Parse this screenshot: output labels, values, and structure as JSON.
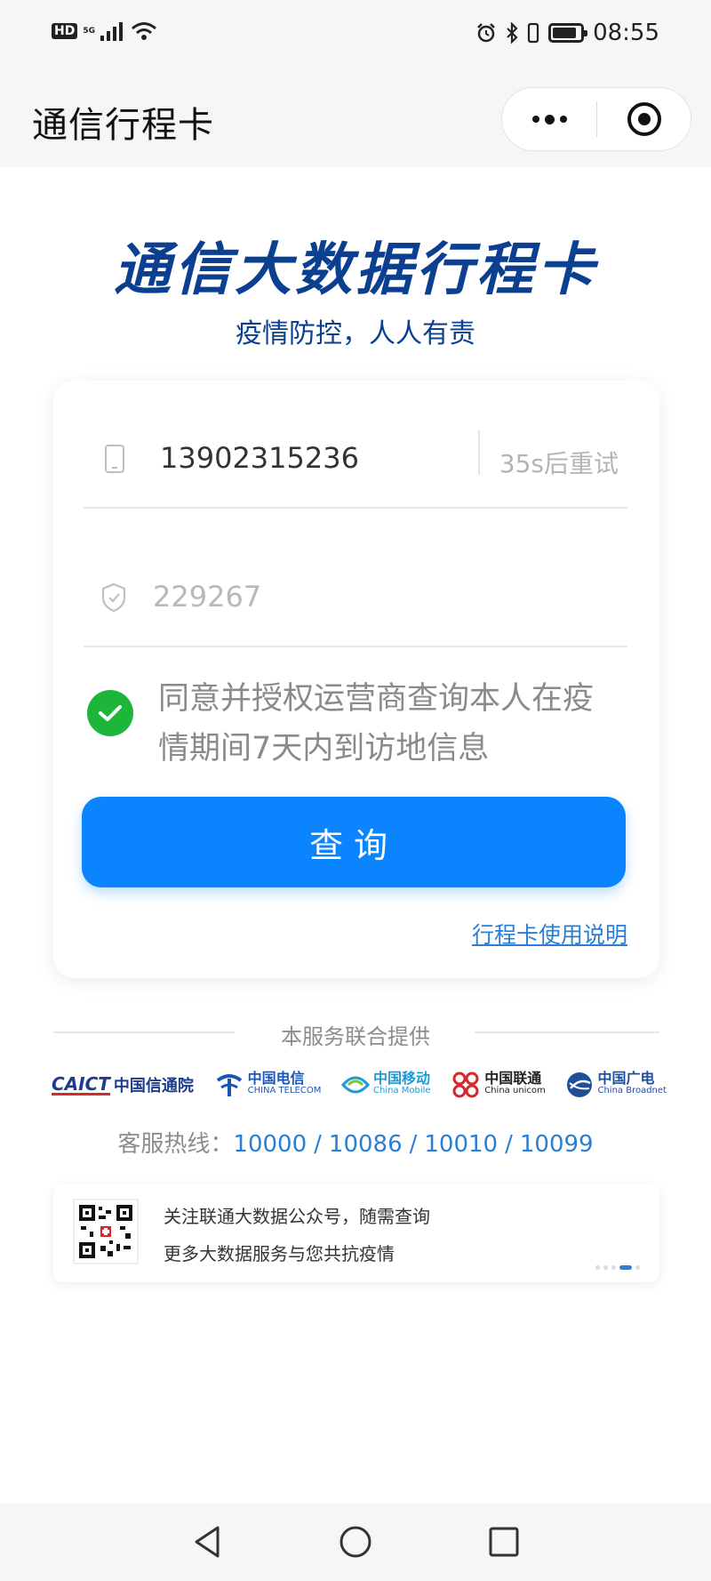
{
  "status_bar": {
    "hd": "HD",
    "network": "5G",
    "time": "08:55",
    "battery_level": 0.85
  },
  "title_bar": {
    "title": "通信行程卡"
  },
  "header": {
    "title": "通信大数据行程卡",
    "subtitle": "疫情防控，人人有责"
  },
  "form": {
    "phone_value": "13902315236",
    "retry_label": "35s后重试",
    "code_value": "229267",
    "agree_checked": true,
    "agree_text": "同意并授权运营商查询本人在疫情期间7天内到访地信息",
    "query_label": "查询",
    "guide_link": "行程卡使用说明"
  },
  "service": {
    "label": "本服务联合提供",
    "providers": {
      "caict_mark": "CAICT",
      "caict_name": "中国信通院",
      "telecom_cn": "中国电信",
      "telecom_en": "CHINA TELECOM",
      "mobile_cn": "中国移动",
      "mobile_en": "China Mobile",
      "unicom_cn": "中国联通",
      "unicom_en": "China unicom",
      "broadnet_cn": "中国广电",
      "broadnet_en": "China Broadnet"
    },
    "hotline_label": "客服热线：",
    "hotlines": [
      "10000",
      "10086",
      "10010",
      "10099"
    ]
  },
  "banner": {
    "line1": "关注联通大数据公众号，随需查询",
    "line2": "更多大数据服务与您共抗疫情"
  },
  "colors": {
    "primary": "#0a84ff",
    "title_blue": "#0b3f8f",
    "link": "#2a7fd4",
    "check_green": "#1db53a"
  }
}
